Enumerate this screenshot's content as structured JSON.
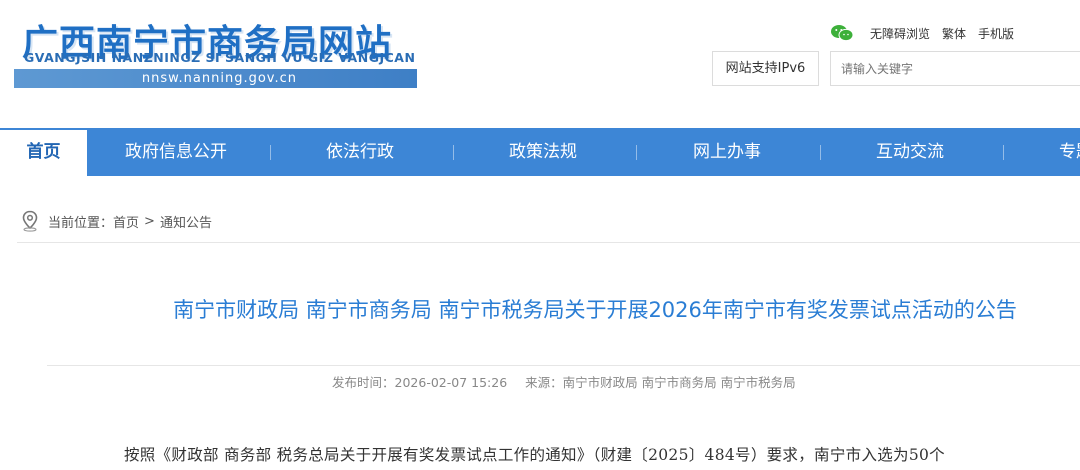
{
  "site": {
    "title": "广西南宁市商务局网站",
    "pinyin": "GVANGJSIH NANZNINGZ SI SANGH VU GIZ VANGJCAN",
    "url": "nnsw.nanning.gov.cn"
  },
  "top_links": [
    "无障碍浏览",
    "繁体",
    "手机版"
  ],
  "ipv6_label": "网站支持IPv6",
  "search": {
    "placeholder": "请输入关键字"
  },
  "nav": {
    "items": [
      "首页",
      "政府信息公开",
      "依法行政",
      "政策法规",
      "网上办事",
      "互动交流",
      "专题"
    ]
  },
  "breadcrumb": {
    "prefix": "当前位置：",
    "home": "首页",
    "separator": ">",
    "current": "通知公告"
  },
  "article": {
    "title": "南宁市财政局 南宁市商务局 南宁市税务局关于开展2026年南宁市有奖发票试点活动的公告",
    "publish_label": "发布时间：",
    "publish_time": "2026-02-07 15:26",
    "source_label": "来源：",
    "source": "南宁市财政局 南宁市商务局 南宁市税务局",
    "body_first_line": "按照《财政部 商务部 税务总局关于开展有奖发票试点工作的通知》（财建〔2025〕484号）要求，南宁市入选为50个"
  },
  "colors": {
    "brand_blue": "#3d86d6",
    "title_blue": "#2a7dd4",
    "wechat_green": "#3db03a"
  },
  "icons": {
    "wechat": "wechat-icon",
    "location": "location-pin-icon"
  }
}
